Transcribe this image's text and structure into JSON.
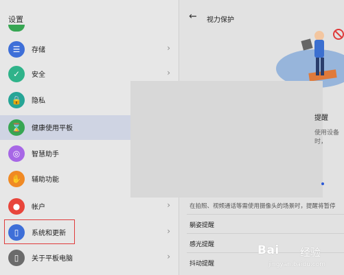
{
  "left_panel": {
    "title": "设置",
    "items": [
      {
        "label": "存储",
        "icon": "storage-icon",
        "color": "#3e6fd8",
        "glyph": "☰"
      },
      {
        "label": "安全",
        "icon": "shield-icon",
        "color": "#2fb38a",
        "glyph": "✓"
      },
      {
        "label": "隐私",
        "icon": "lock-icon",
        "color": "#26a596",
        "glyph": "🔒"
      },
      {
        "label": "健康使用平板",
        "icon": "hourglass-icon",
        "color": "#37a653",
        "glyph": "⌛"
      },
      {
        "label": "智慧助手",
        "icon": "assistant-icon",
        "color": "#a767e6",
        "glyph": "◎"
      },
      {
        "label": "辅助功能",
        "icon": "hand-icon",
        "color": "#f08a24",
        "glyph": "✋"
      },
      {
        "label": "帐户",
        "icon": "account-icon",
        "color": "#e8453b",
        "glyph": "●"
      },
      {
        "label": "系统和更新",
        "icon": "system-update-icon",
        "color": "#3e6fd8",
        "glyph": "▯"
      },
      {
        "label": "关于平板电脑",
        "icon": "info-icon",
        "color": "#6b6b6b",
        "glyph": "▯"
      }
    ]
  },
  "right_panel": {
    "title": "视力保护",
    "remind_title": "提醒",
    "remind_sub": "使用设备时，",
    "description": "在拍照、视频通话等需使用摄像头的场景时，提醒将暂停",
    "options": [
      "躺姿提醒",
      "感光提醒",
      "抖动提醒"
    ]
  },
  "watermark": {
    "brand": "Bai",
    "brand2": "经验",
    "url": "jingyan.baidu.com"
  },
  "colors": {
    "highlight": "#cfd4e3",
    "red_box": "#e03a3a",
    "accent": "#2c59d6"
  }
}
